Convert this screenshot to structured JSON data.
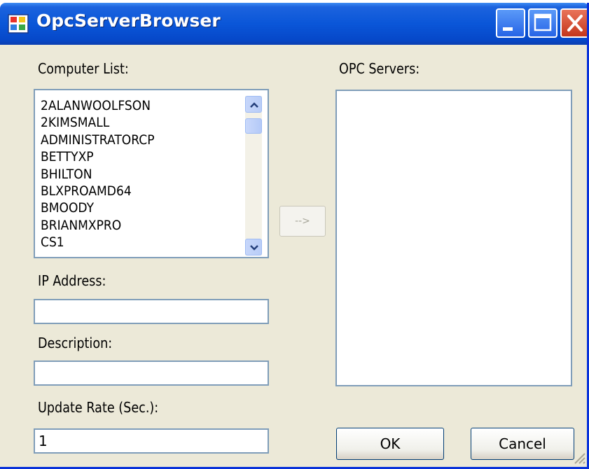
{
  "window": {
    "title": "OpcServerBrowser",
    "accent": "#0a56d8"
  },
  "labels": {
    "computer_list": "Computer List:",
    "opc_servers": "OPC Servers:",
    "ip_address": "IP Address:",
    "description": "Description:",
    "update_rate": "Update Rate (Sec.):"
  },
  "computer_list": {
    "items": [
      "2ALANWOOLFSON",
      "2KIMSMALL",
      "ADMINISTRATORCP",
      "BETTYXP",
      "BHILTON",
      "BLXPROAMD64",
      "BMOODY",
      "BRIANMXPRO",
      "CS1"
    ],
    "scroll_up_icon": "chevron-up-icon",
    "scroll_down_icon": "chevron-down-icon"
  },
  "arrow_button": {
    "label": "-->"
  },
  "fields": {
    "ip_address": "",
    "description": "",
    "update_rate": "1"
  },
  "buttons": {
    "ok": "OK",
    "cancel": "Cancel"
  }
}
